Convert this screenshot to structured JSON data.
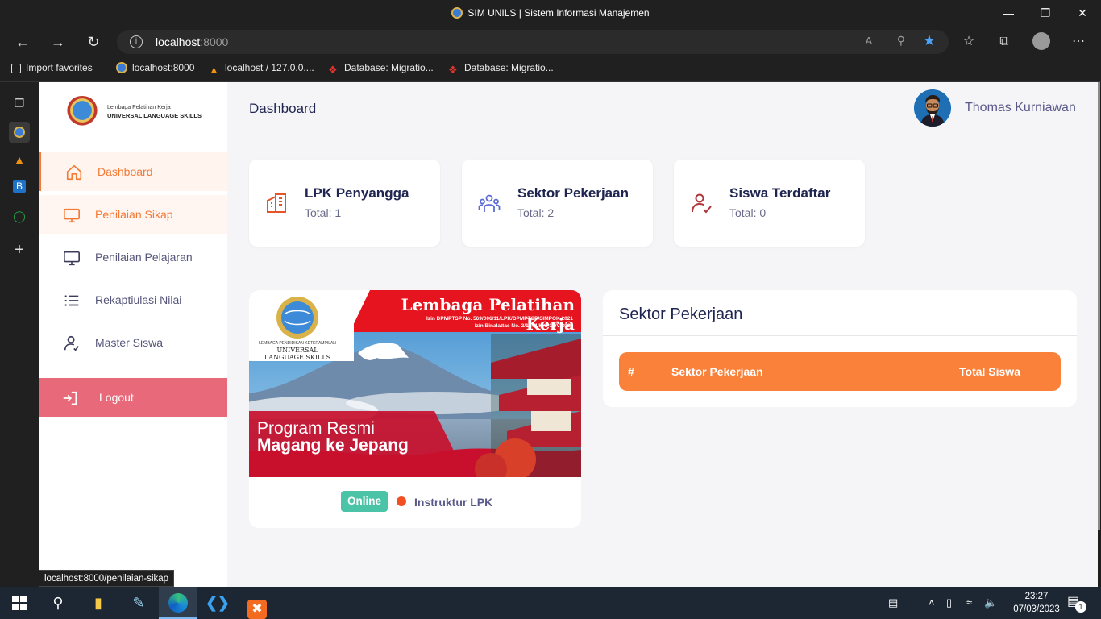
{
  "browser": {
    "window_title": "SIM UNILS | Sistem Informasi Manajemen",
    "url_host": "localhost",
    "url_port": ":8000",
    "bookmarks": [
      {
        "label": "Import favorites"
      },
      {
        "label": "localhost:8000"
      },
      {
        "label": "localhost / 127.0.0...."
      },
      {
        "label": "Database: Migratio..."
      },
      {
        "label": "Database: Migratio..."
      }
    ],
    "status_url": "localhost:8000/penilaian-sikap"
  },
  "sidebar": {
    "logo_line1": "Lembaga Pelatihan Kerja",
    "logo_line2": "UNIVERSAL LANGUAGE SKILLS",
    "items": [
      {
        "label": "Dashboard",
        "icon": "home-icon",
        "state": "active"
      },
      {
        "label": "Penilaian Sikap",
        "icon": "monitor-icon",
        "state": "hover"
      },
      {
        "label": "Penilaian Pelajaran",
        "icon": "monitor-icon",
        "state": "normal"
      },
      {
        "label": "Rekaptiulasi Nilai",
        "icon": "list-icon",
        "state": "normal"
      },
      {
        "label": "Master Siswa",
        "icon": "user-check-icon",
        "state": "normal"
      }
    ],
    "logout_label": "Logout"
  },
  "header": {
    "page_title": "Dashboard",
    "user_name": "Thomas Kurniawan"
  },
  "stats": [
    {
      "title": "LPK Penyangga",
      "subtitle": "Total: 1",
      "icon": "building-icon"
    },
    {
      "title": "Sektor Pekerjaan",
      "subtitle": "Total: 2",
      "icon": "users-icon"
    },
    {
      "title": "Siswa Terdaftar",
      "subtitle": "Total: 0",
      "icon": "user-check-icon"
    }
  ],
  "banner": {
    "heading": "Lembaga Pelatihan Kerja",
    "permit1": "Izin DPMPTSP No. 569/006/11/LPK/DPMPTSP/SIMPOK 2021",
    "permit2": "Izin Binalattas No. 2/1044/HK. 13/V/2021",
    "logo_line1": "LEMBAGA PENDIDIKAN KETERAMPILAN",
    "logo_line2": "UNIVERSAL",
    "logo_line3": "LANGUAGE SKILLS",
    "program_line1": "Program Resmi",
    "program_line2": "Magang ke Jepang",
    "status_badge": "Online",
    "role": "Instruktur LPK"
  },
  "sektor_table": {
    "title": "Sektor Pekerjaan",
    "columns": [
      "#",
      "Sektor Pekerjaan",
      "Total Siswa"
    ],
    "rows": []
  },
  "taskbar": {
    "time": "23:27",
    "date": "07/03/2023",
    "notification_count": "1"
  },
  "colors": {
    "accent": "#f47a35",
    "table_header": "#f9813a",
    "logout": "#e86a7a",
    "online": "#4bc3a6",
    "navy": "#1f2450"
  }
}
